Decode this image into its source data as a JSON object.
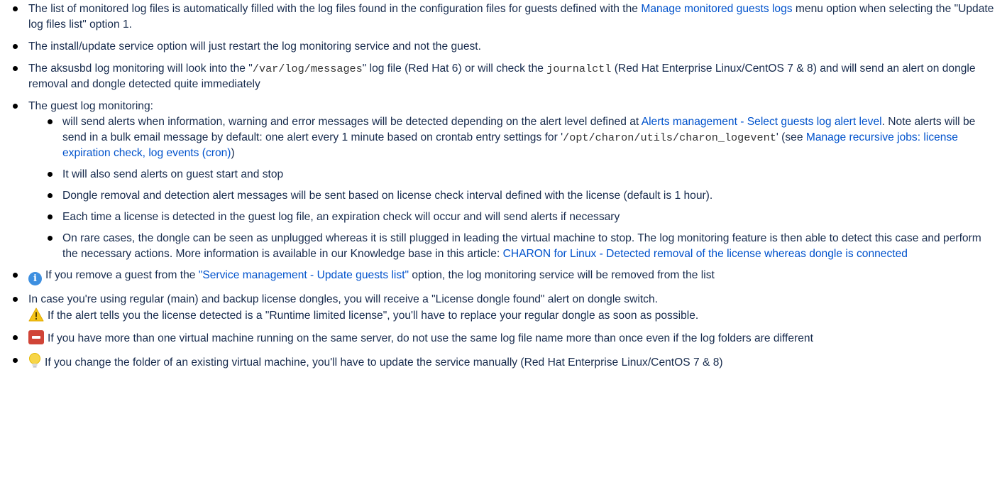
{
  "items": [
    {
      "t1": "The list of monitored log files is automatically filled with the log files found in the configuration files for guests defined with the ",
      "link": "Manage monitored guests logs",
      "t2": " menu option when selecting the \"Update log files list\" option 1."
    },
    {
      "t1": "The install/update service option will just restart the log monitoring service and not the guest."
    },
    {
      "t1": "The aksusbd log monitoring will look into the \"",
      "code1": "/var/log/messages",
      "t2": "\" log file (Red Hat 6) or will check the ",
      "code2": "journalctl",
      "t3": " (Red Hat Enterprise Linux/CentOS 7 & 8) and will send an alert on dongle removal and dongle detected quite immediately"
    },
    {
      "t1": "The guest log monitoring:",
      "sub": [
        {
          "t1": "will send alerts when information, warning and error messages will be detected depending on the alert level defined at ",
          "link1": "Alerts management - Select guests log alert level",
          "t2": ". Note alerts will be send in a bulk email message by default: one alert every 1 minute based on crontab entry settings for '",
          "code": "/opt/charon/utils/charon_logevent",
          "t3": "' (see ",
          "link2": "Manage recursive jobs: license expiration check, log events (cron)",
          "t4": ")"
        },
        {
          "t1": "It will also send alerts on guest start and stop"
        },
        {
          "t1": "Dongle removal and detection alert messages will be sent based on license check interval defined with the license (default is 1 hour)."
        },
        {
          "t1": "Each time a license is detected in the guest log file, an expiration check will occur and will send alerts if necessary"
        },
        {
          "t1": "On rare cases, the dongle can be seen as unplugged whereas it is still plugged in leading the virtual machine to stop. The log monitoring feature is then able to detect this case and perform the necessary actions. More information is available in our Knowledge base in this article: ",
          "link": "CHARON for Linux - Detected removal of the license whereas dongle is connected"
        }
      ]
    },
    {
      "icon": "info-icon",
      "t1": "If you remove a guest from the ",
      "link": "\"Service management - Update guests list\"",
      "t2": " option, the log monitoring service will be removed from the list"
    },
    {
      "t1": "In case you're using regular (main) and backup license dongles, you will receive a \"License dongle found\" alert on dongle switch.",
      "icon2": "warning-icon",
      "t2": "If the alert tells you the license detected is a \"Runtime limited license\", you'll have to replace your regular dongle as soon as possible."
    },
    {
      "icon": "stop-icon",
      "t1": "If you have more than one virtual machine running on the same server, do not use the same log file name more than once even if the log folders are different"
    },
    {
      "icon": "lightbulb-icon",
      "t1": "If you change the folder of an existing virtual machine, you'll have to update the service manually (Red Hat Enterprise Linux/CentOS 7 & 8)"
    }
  ],
  "colors": {
    "link": "#0052cc",
    "text": "#172b4d",
    "info": "#3d8fe0",
    "warning": "#f5c518",
    "error": "#d04437",
    "tip": "#f7d548"
  }
}
